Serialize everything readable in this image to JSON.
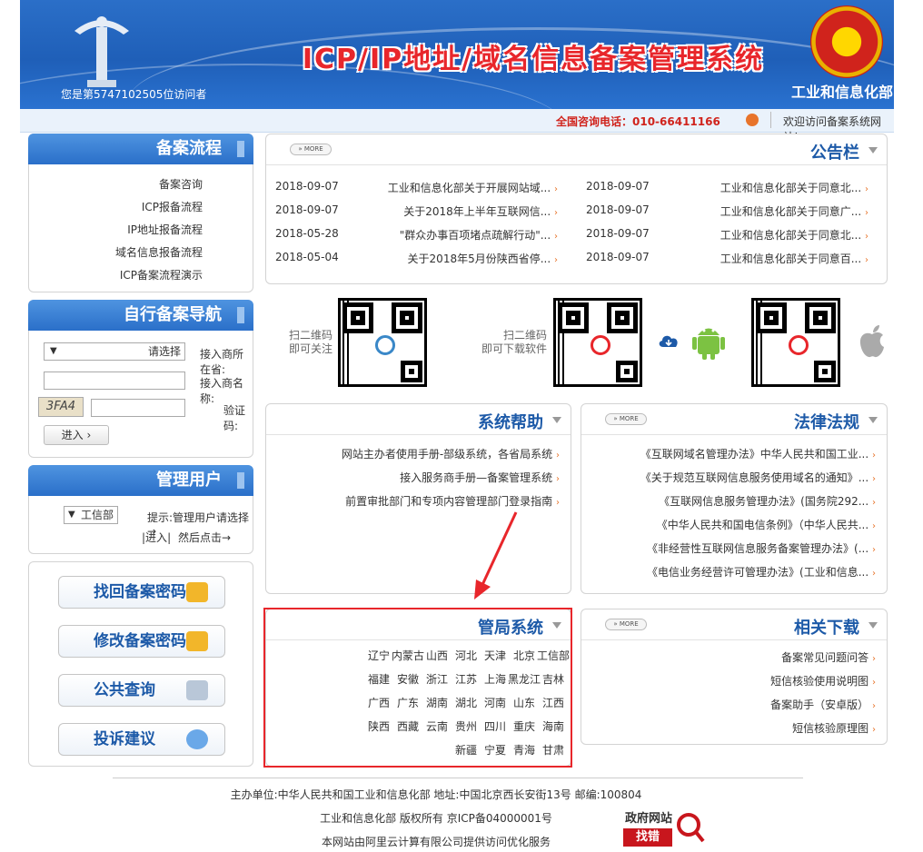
{
  "header": {
    "title": "ICP/IP地址/域名信息备案管理系统",
    "org": "工业和信息化部",
    "visitor_text": "您是第5747102505位访问者"
  },
  "topbar": {
    "welcome": "欢迎访问备案系统网站!",
    "hotline": "全国咨询电话：010-66411166"
  },
  "process": {
    "title": "备案流程",
    "items": [
      "备案咨询",
      "ICP报备流程",
      "IP地址报备流程",
      "域名信息报备流程",
      "ICP备案流程演示"
    ]
  },
  "self_nav": {
    "title": "自行备案导航",
    "province_label": "接入商所在省:",
    "province_value": "请选择",
    "name_label": "接入商名称:",
    "captcha_label": "验证码:",
    "captcha_image": "3FA4",
    "enter_label": "进入"
  },
  "mgmt": {
    "title": "管理用户",
    "prompt": "提示:管理用户请选择→",
    "select_value": "工信部",
    "then": "然后点击→",
    "enter_link": "进入"
  },
  "buttons": {
    "find_pwd": "找回备案密码",
    "change_pwd": "修改备案密码",
    "query": "公共查询",
    "complain": "投诉建议"
  },
  "notice": {
    "title": "公告栏",
    "more": "MORE",
    "col_right": [
      {
        "text": "工业和信息化部关于同意北...",
        "date": "2018-09-07"
      },
      {
        "text": "工业和信息化部关于同意广...",
        "date": "2018-09-07"
      },
      {
        "text": "工业和信息化部关于同意北...",
        "date": "2018-09-07"
      },
      {
        "text": "工业和信息化部关于同意百...",
        "date": "2018-09-07"
      }
    ],
    "col_left": [
      {
        "text": "工业和信息化部关于开展网站域...",
        "date": "2018-09-07"
      },
      {
        "text": "关于2018年上半年互联网信...",
        "date": "2018-09-07"
      },
      {
        "text": "\"群众办事百项堵点疏解行动\"...",
        "date": "2018-05-28"
      },
      {
        "text": "关于2018年5月份陕西省停...",
        "date": "2018-05-04"
      }
    ]
  },
  "qr": {
    "cap_software": "扫二维码\n即可下载软件",
    "cap_follow": "扫二维码\n即可关注"
  },
  "law": {
    "title": "法律法规",
    "more": "MORE",
    "items": [
      "《互联网域名管理办法》中华人民共和国工业...",
      "《关于规范互联网信息服务使用域名的通知》...",
      "《互联网信息服务管理办法》(国务院292...",
      "《中华人民共和国电信条例》（中华人民共...",
      "《非经营性互联网信息服务备案管理办法》(...",
      "《电信业务经营许可管理办法》(工业和信息..."
    ]
  },
  "help": {
    "title": "系统帮助",
    "items": [
      "网站主办者使用手册-部级系统，各省局系统",
      "接入服务商手册—备案管理系统",
      "前置审批部门和专项内容管理部门登录指南"
    ]
  },
  "bureau": {
    "title": "管局系统",
    "rows": [
      [
        "工信部",
        "北京",
        "天津",
        "河北",
        "山西",
        "内蒙古",
        "辽宁"
      ],
      [
        "吉林",
        "黑龙江",
        "上海",
        "江苏",
        "浙江",
        "安徽",
        "福建"
      ],
      [
        "江西",
        "山东",
        "河南",
        "湖北",
        "湖南",
        "广东",
        "广西"
      ],
      [
        "海南",
        "重庆",
        "四川",
        "贵州",
        "云南",
        "西藏",
        "陕西"
      ],
      [
        "甘肃",
        "青海",
        "宁夏",
        "新疆"
      ]
    ]
  },
  "download": {
    "title": "相关下载",
    "more": "MORE",
    "items": [
      "备案常见问题问答",
      "短信核验使用说明图",
      "备案助手（安卓版）",
      "短信核验原理图"
    ]
  },
  "footer": {
    "line1": "主办单位:中华人民共和国工业和信息化部 地址:中国北京西长安街13号 邮编:100804",
    "line2": "工业和信息化部 版权所有 京ICP备04000001号",
    "line3": "本网站由阿里云计算有限公司提供访问优化服务",
    "gov_badge_top": "政府网站",
    "gov_badge_bottom": "找错"
  }
}
